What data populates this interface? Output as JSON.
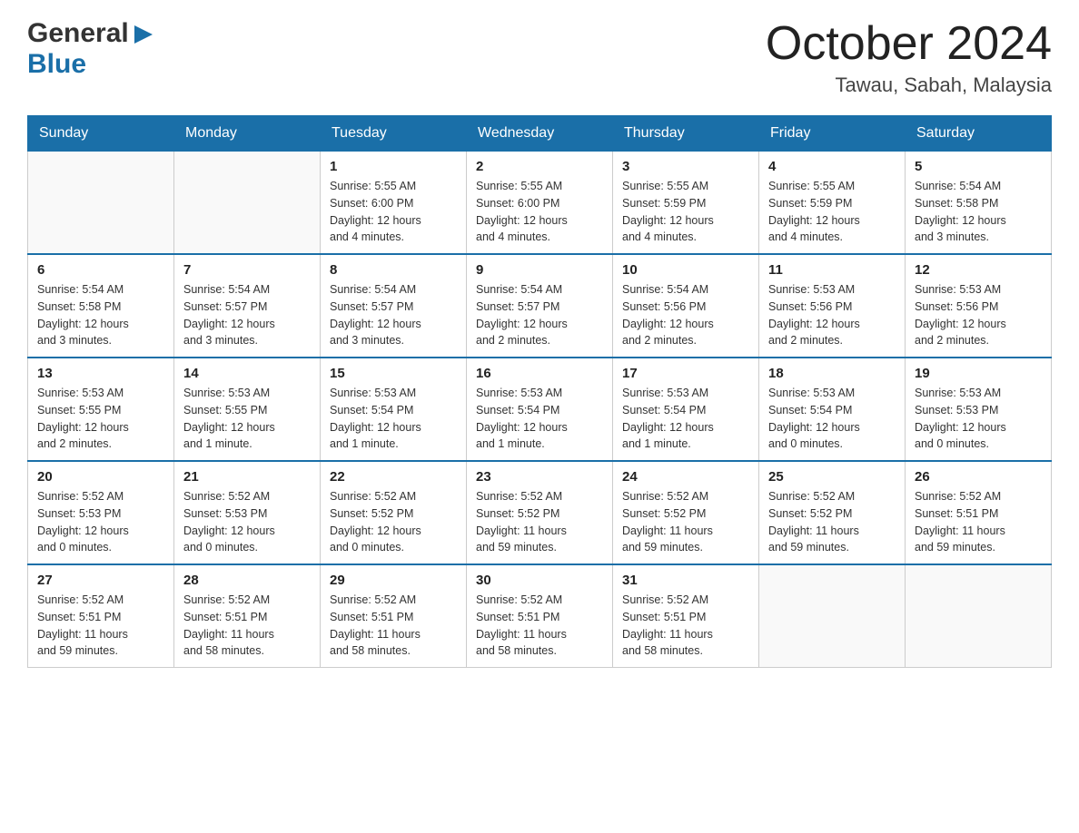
{
  "header": {
    "logo_general": "General",
    "logo_blue": "Blue",
    "month_title": "October 2024",
    "location": "Tawau, Sabah, Malaysia"
  },
  "days_of_week": [
    "Sunday",
    "Monday",
    "Tuesday",
    "Wednesday",
    "Thursday",
    "Friday",
    "Saturday"
  ],
  "weeks": [
    [
      {
        "day": "",
        "info": ""
      },
      {
        "day": "",
        "info": ""
      },
      {
        "day": "1",
        "info": "Sunrise: 5:55 AM\nSunset: 6:00 PM\nDaylight: 12 hours\nand 4 minutes."
      },
      {
        "day": "2",
        "info": "Sunrise: 5:55 AM\nSunset: 6:00 PM\nDaylight: 12 hours\nand 4 minutes."
      },
      {
        "day": "3",
        "info": "Sunrise: 5:55 AM\nSunset: 5:59 PM\nDaylight: 12 hours\nand 4 minutes."
      },
      {
        "day": "4",
        "info": "Sunrise: 5:55 AM\nSunset: 5:59 PM\nDaylight: 12 hours\nand 4 minutes."
      },
      {
        "day": "5",
        "info": "Sunrise: 5:54 AM\nSunset: 5:58 PM\nDaylight: 12 hours\nand 3 minutes."
      }
    ],
    [
      {
        "day": "6",
        "info": "Sunrise: 5:54 AM\nSunset: 5:58 PM\nDaylight: 12 hours\nand 3 minutes."
      },
      {
        "day": "7",
        "info": "Sunrise: 5:54 AM\nSunset: 5:57 PM\nDaylight: 12 hours\nand 3 minutes."
      },
      {
        "day": "8",
        "info": "Sunrise: 5:54 AM\nSunset: 5:57 PM\nDaylight: 12 hours\nand 3 minutes."
      },
      {
        "day": "9",
        "info": "Sunrise: 5:54 AM\nSunset: 5:57 PM\nDaylight: 12 hours\nand 2 minutes."
      },
      {
        "day": "10",
        "info": "Sunrise: 5:54 AM\nSunset: 5:56 PM\nDaylight: 12 hours\nand 2 minutes."
      },
      {
        "day": "11",
        "info": "Sunrise: 5:53 AM\nSunset: 5:56 PM\nDaylight: 12 hours\nand 2 minutes."
      },
      {
        "day": "12",
        "info": "Sunrise: 5:53 AM\nSunset: 5:56 PM\nDaylight: 12 hours\nand 2 minutes."
      }
    ],
    [
      {
        "day": "13",
        "info": "Sunrise: 5:53 AM\nSunset: 5:55 PM\nDaylight: 12 hours\nand 2 minutes."
      },
      {
        "day": "14",
        "info": "Sunrise: 5:53 AM\nSunset: 5:55 PM\nDaylight: 12 hours\nand 1 minute."
      },
      {
        "day": "15",
        "info": "Sunrise: 5:53 AM\nSunset: 5:54 PM\nDaylight: 12 hours\nand 1 minute."
      },
      {
        "day": "16",
        "info": "Sunrise: 5:53 AM\nSunset: 5:54 PM\nDaylight: 12 hours\nand 1 minute."
      },
      {
        "day": "17",
        "info": "Sunrise: 5:53 AM\nSunset: 5:54 PM\nDaylight: 12 hours\nand 1 minute."
      },
      {
        "day": "18",
        "info": "Sunrise: 5:53 AM\nSunset: 5:54 PM\nDaylight: 12 hours\nand 0 minutes."
      },
      {
        "day": "19",
        "info": "Sunrise: 5:53 AM\nSunset: 5:53 PM\nDaylight: 12 hours\nand 0 minutes."
      }
    ],
    [
      {
        "day": "20",
        "info": "Sunrise: 5:52 AM\nSunset: 5:53 PM\nDaylight: 12 hours\nand 0 minutes."
      },
      {
        "day": "21",
        "info": "Sunrise: 5:52 AM\nSunset: 5:53 PM\nDaylight: 12 hours\nand 0 minutes."
      },
      {
        "day": "22",
        "info": "Sunrise: 5:52 AM\nSunset: 5:52 PM\nDaylight: 12 hours\nand 0 minutes."
      },
      {
        "day": "23",
        "info": "Sunrise: 5:52 AM\nSunset: 5:52 PM\nDaylight: 11 hours\nand 59 minutes."
      },
      {
        "day": "24",
        "info": "Sunrise: 5:52 AM\nSunset: 5:52 PM\nDaylight: 11 hours\nand 59 minutes."
      },
      {
        "day": "25",
        "info": "Sunrise: 5:52 AM\nSunset: 5:52 PM\nDaylight: 11 hours\nand 59 minutes."
      },
      {
        "day": "26",
        "info": "Sunrise: 5:52 AM\nSunset: 5:51 PM\nDaylight: 11 hours\nand 59 minutes."
      }
    ],
    [
      {
        "day": "27",
        "info": "Sunrise: 5:52 AM\nSunset: 5:51 PM\nDaylight: 11 hours\nand 59 minutes."
      },
      {
        "day": "28",
        "info": "Sunrise: 5:52 AM\nSunset: 5:51 PM\nDaylight: 11 hours\nand 58 minutes."
      },
      {
        "day": "29",
        "info": "Sunrise: 5:52 AM\nSunset: 5:51 PM\nDaylight: 11 hours\nand 58 minutes."
      },
      {
        "day": "30",
        "info": "Sunrise: 5:52 AM\nSunset: 5:51 PM\nDaylight: 11 hours\nand 58 minutes."
      },
      {
        "day": "31",
        "info": "Sunrise: 5:52 AM\nSunset: 5:51 PM\nDaylight: 11 hours\nand 58 minutes."
      },
      {
        "day": "",
        "info": ""
      },
      {
        "day": "",
        "info": ""
      }
    ]
  ]
}
